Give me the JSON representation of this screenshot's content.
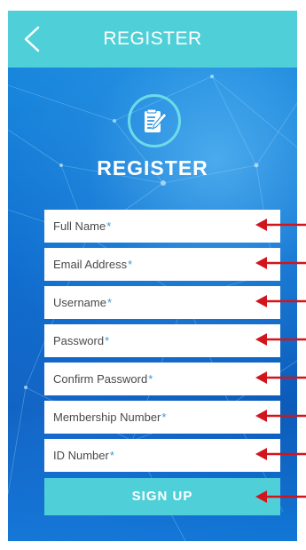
{
  "header": {
    "title": "REGISTER",
    "back_icon": "chevron-left-icon"
  },
  "logo": {
    "icon": "edit-document-icon"
  },
  "page_title": "REGISTER",
  "fields": [
    {
      "label": "Full Name",
      "required": "*"
    },
    {
      "label": "Email Address",
      "required": "*"
    },
    {
      "label": "Username",
      "required": "*"
    },
    {
      "label": "Password",
      "required": "*"
    },
    {
      "label": "Confirm Password",
      "required": "*"
    },
    {
      "label": "Membership Number",
      "required": "*"
    },
    {
      "label": "ID Number",
      "required": "*"
    }
  ],
  "signup_label": "SIGN UP",
  "colors": {
    "header": "#4fd0d8",
    "button": "#4fd0d8",
    "required_star": "#3a9ad9",
    "arrow": "#d0161c"
  }
}
